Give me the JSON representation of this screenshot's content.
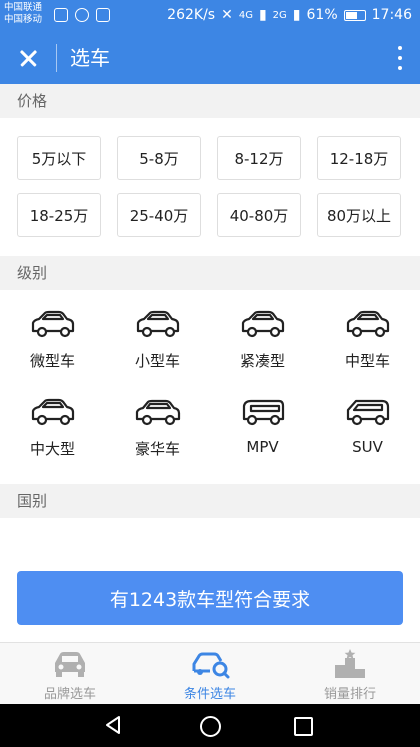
{
  "status_bar": {
    "carrier_1": "中国联通",
    "carrier_2": "中国移动",
    "net_speed": "262K/s",
    "signal_1": "4G",
    "signal_2": "2G",
    "battery_percent": "61%",
    "time": "17:46"
  },
  "app_bar": {
    "title": "选车"
  },
  "price_section": {
    "header": "价格",
    "options": [
      "5万以下",
      "5-8万",
      "8-12万",
      "12-18万",
      "18-25万",
      "25-40万",
      "40-80万",
      "80万以上"
    ]
  },
  "level_section": {
    "header": "级别",
    "options": [
      {
        "label": "微型车",
        "icon": "micro-car-icon"
      },
      {
        "label": "小型车",
        "icon": "small-car-icon"
      },
      {
        "label": "紧凑型",
        "icon": "compact-car-icon"
      },
      {
        "label": "中型车",
        "icon": "midsize-car-icon"
      },
      {
        "label": "中大型",
        "icon": "large-car-icon"
      },
      {
        "label": "豪华车",
        "icon": "luxury-car-icon"
      },
      {
        "label": "MPV",
        "icon": "mpv-icon"
      },
      {
        "label": "SUV",
        "icon": "suv-icon"
      }
    ]
  },
  "country_section": {
    "header": "国别"
  },
  "cta": {
    "label": "有1243款车型符合要求"
  },
  "tabs": [
    {
      "label": "品牌选车",
      "icon": "car-front-icon",
      "active": false
    },
    {
      "label": "条件选车",
      "icon": "car-search-icon",
      "active": true
    },
    {
      "label": "销量排行",
      "icon": "ranking-podium-icon",
      "active": false
    }
  ],
  "colors": {
    "primary": "#3d86e4",
    "cta": "#4e8ef2",
    "section_bg": "#f2f2f2",
    "tab_inactive": "#999999"
  }
}
